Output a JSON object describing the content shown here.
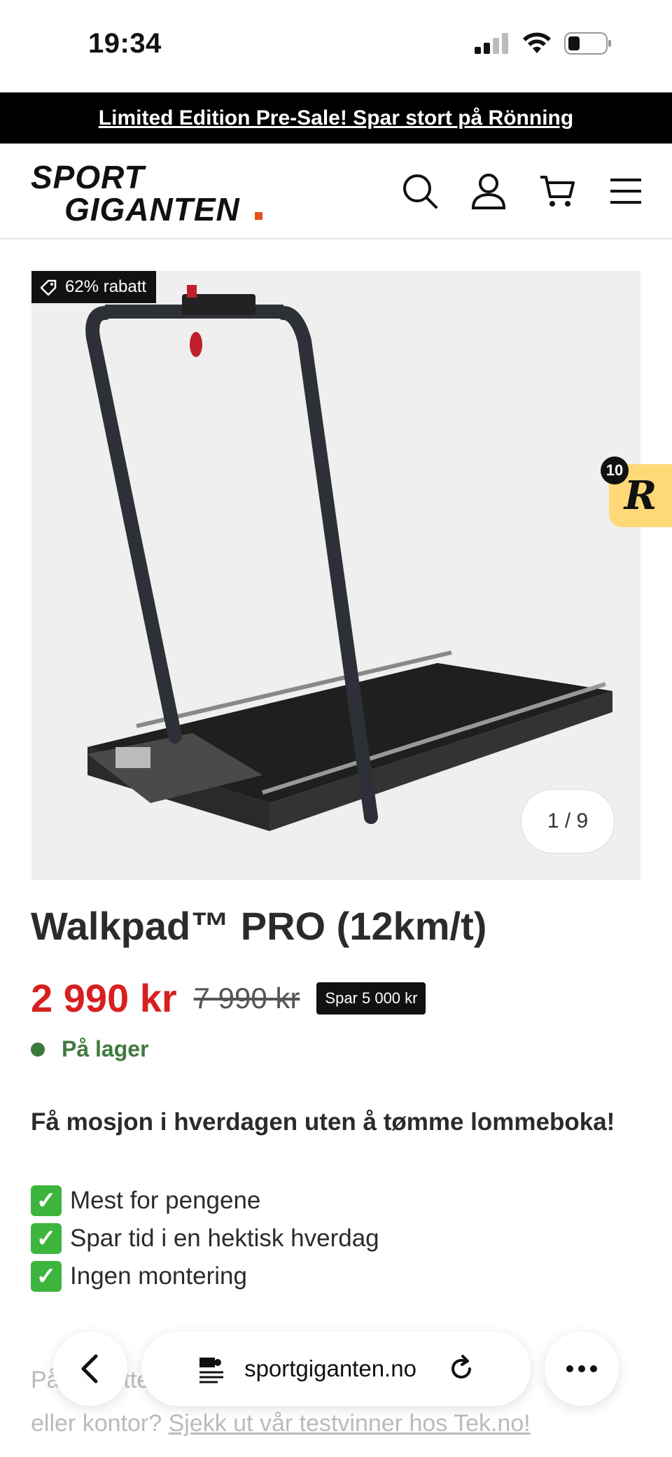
{
  "status": {
    "time": "19:34"
  },
  "announcement": "Limited Edition Pre-Sale! Spar stort på Rönning",
  "logo": {
    "line1": "SPORT",
    "line2": "GIGANTEN",
    "accent": "."
  },
  "product": {
    "discount_badge": "62% rabatt",
    "image_counter": "1 / 9",
    "reviews_count": "10",
    "reviews_letter": "R",
    "title": "Walkpad™ PRO (12km/t)",
    "price": "2 990 kr",
    "old_price": "7 990 kr",
    "save_badge": "Spar 5 000 kr",
    "stock": "På lager",
    "tagline": "Få mosjon i hverdagen uten å tømme lommeboka!",
    "features": [
      "Mest for pengene",
      "Spar tid i en hektisk hverdag",
      "Ingen montering"
    ],
    "bottom_line1": "På jakt etter en tredemølle til hjem",
    "bottom_line2_prefix": "eller kontor?",
    "bottom_link": "Sjekk ut vår testvinner hos Tek.no!"
  },
  "browser": {
    "url": "sportgiganten.no"
  },
  "colors": {
    "price": "#d81f1f",
    "stock": "#3f7a3f",
    "logo_accent": "#e8501f",
    "reviews_bg": "#ffd978"
  }
}
